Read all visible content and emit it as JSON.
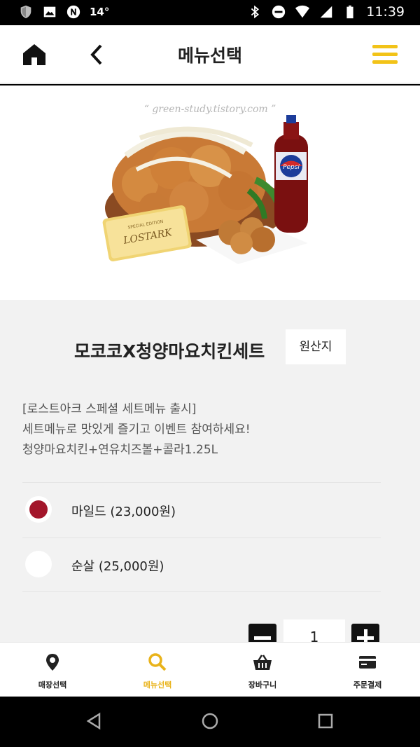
{
  "status_bar": {
    "temperature": "14°",
    "time": "11:39",
    "left_icons": [
      "shield-icon",
      "image-icon",
      "n-app-icon"
    ],
    "right_icons": [
      "bluetooth-icon",
      "do-not-disturb-icon",
      "wifi-icon",
      "signal-icon",
      "battery-icon"
    ]
  },
  "header": {
    "title": "메뉴선택",
    "home_icon": "home-icon",
    "back_icon": "back-chevron-icon",
    "menu_icon": "hamburger-menu-icon",
    "accent_color": "#f2c318"
  },
  "hero": {
    "watermark": "green-study.tistory.com",
    "ticket_text": "LOSTARK",
    "ticket_small_text": "SPECIAL EDITION",
    "bottle_label": "Pepsi"
  },
  "product": {
    "name": "모코코X청양마요치킨세트",
    "origin_button": "원산지",
    "description": [
      "[로스트아크 스페셜 세트메뉴 출시]",
      "세트메뉴로 맛있게 즐기고 이벤트 참여하세요!",
      "청양마요치킨+연유치즈볼+콜라1.25L"
    ]
  },
  "options": [
    {
      "label": "마일드 (23,000원)",
      "selected": true
    },
    {
      "label": "순살 (25,000원)",
      "selected": false
    }
  ],
  "selected_color": "#a3162b",
  "quantity": {
    "value": "1",
    "minus_icon": "minus-icon",
    "plus_icon": "plus-icon"
  },
  "bottom_nav": [
    {
      "label": "매장선택",
      "icon": "location-pin-icon",
      "active": false
    },
    {
      "label": "메뉴선택",
      "icon": "search-icon",
      "active": true
    },
    {
      "label": "장바구니",
      "icon": "basket-icon",
      "active": false
    },
    {
      "label": "주문결제",
      "icon": "credit-card-icon",
      "active": false
    }
  ],
  "active_nav_color": "#e9b31a",
  "system_nav": [
    "back-triangle-icon",
    "home-circle-icon",
    "recents-square-icon"
  ]
}
